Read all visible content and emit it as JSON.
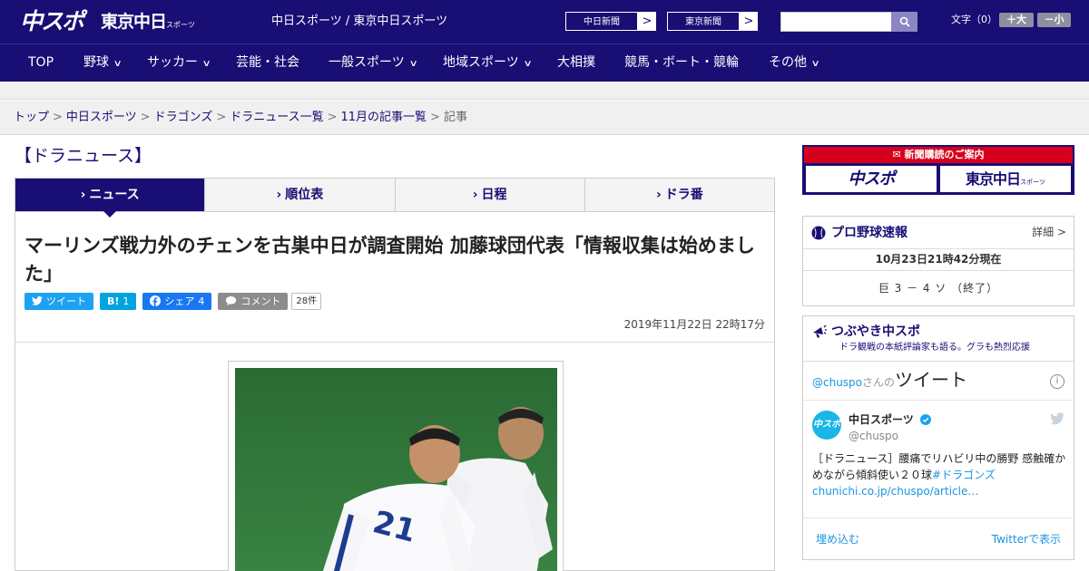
{
  "header": {
    "logo_chuspo": "中スポ",
    "logo_tokyo": "東京中日",
    "logo_tokyo_small": "スポーツ",
    "site_name": "中日スポーツ / 東京中日スポーツ",
    "paper_links": [
      {
        "label": "中日新聞",
        "arrow": ">"
      },
      {
        "label": "東京新聞",
        "arrow": ">"
      }
    ],
    "search": {
      "placeholder": "",
      "icon": "search-icon"
    },
    "font_size_label": "文字（0）",
    "font_larger": "＋大",
    "font_smaller": "－小"
  },
  "nav": {
    "items": [
      {
        "label": "TOP",
        "dropdown": false
      },
      {
        "label": "野球",
        "dropdown": true
      },
      {
        "label": "サッカー",
        "dropdown": true
      },
      {
        "label": "芸能・社会",
        "dropdown": false
      },
      {
        "label": "一般スポーツ",
        "dropdown": true
      },
      {
        "label": "地域スポーツ",
        "dropdown": true
      },
      {
        "label": "大相撲",
        "dropdown": false
      },
      {
        "label": "競馬・ボート・競輪",
        "dropdown": false
      },
      {
        "label": "その他",
        "dropdown": true
      }
    ],
    "chevron": "∨"
  },
  "breadcrumb": {
    "items": [
      "トップ",
      "中日スポーツ",
      "ドラゴンズ",
      "ドラニュース一覧",
      "11月の記事一覧"
    ],
    "current": "記事",
    "separator": ">"
  },
  "section": {
    "title": "【ドラニュース】",
    "tabs": [
      {
        "label": "ニュース",
        "active": true
      },
      {
        "label": "順位表",
        "active": false
      },
      {
        "label": "日程",
        "active": false
      },
      {
        "label": "ドラ番",
        "active": false
      }
    ]
  },
  "article": {
    "headline": "マーリンズ戦力外のチェンを古巣中日が調査開始 加藤球団代表「情報収集は始めました」",
    "social": {
      "tweet": "ツイート",
      "hatena_icon": "B!",
      "hatena_count": "1",
      "facebook": "シェア",
      "facebook_count": "4",
      "comment": "コメント",
      "comment_count": "28件"
    },
    "published": "2019年11月22日 22時17分"
  },
  "sidebar": {
    "subscription": {
      "banner": "新聞購読のご案内",
      "logo_chuspo": "中スポ",
      "logo_tokyo": "東京中日",
      "logo_tokyo_small": "スポーツ"
    },
    "baseball": {
      "title": "プロ野球速報",
      "detail": "詳細 >",
      "updated": "10月23日21時42分現在",
      "score": "巨 3 － 4 ソ （終了）"
    },
    "tweets": {
      "title": "つぶやき中スポ",
      "subtitle": "ドラ観戦の本紙評論家も語る。グラも熱烈応援",
      "account": "@chuspo",
      "san": "さんの",
      "heading": "ツイート",
      "info": "i",
      "avatar_text": "中スポ",
      "name": "中日スポーツ",
      "handle": "@chuspo",
      "text_main": "［ドラニュース］腰痛でリハビリ中の勝野 感触確かめながら傾斜使い２０球",
      "text_tag": "#ドラゴンズ",
      "text_link": "chunichi.co.jp/chuspo/article…",
      "embed": "埋め込む",
      "view": "Twitterで表示"
    }
  },
  "colors": {
    "brand": "#180e74",
    "accent_red": "#d6001c",
    "twitter": "#1da1f2",
    "hatena": "#00a4de",
    "facebook": "#1877f2",
    "comment": "#8c8c8c"
  }
}
